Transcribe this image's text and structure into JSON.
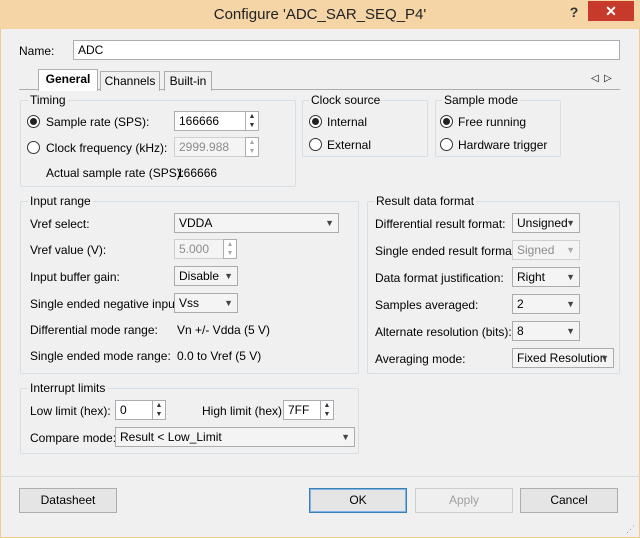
{
  "window": {
    "title": "Configure 'ADC_SAR_SEQ_P4'",
    "help": "?",
    "close": "✕"
  },
  "name": {
    "label": "Name:",
    "value": "ADC"
  },
  "tabs": [
    {
      "label": "General"
    },
    {
      "label": "Channels"
    },
    {
      "label": "Built-in"
    }
  ],
  "tab_scroll": {
    "left": "◁",
    "right": "▷"
  },
  "timing": {
    "title": "Timing",
    "sample_rate_label": "Sample rate (SPS):",
    "sample_rate_value": "166666",
    "clock_freq_label": "Clock frequency (kHz):",
    "clock_freq_value": "2999.988",
    "actual_rate_label": "Actual sample rate (SPS):",
    "actual_rate_value": "166666"
  },
  "clock_source": {
    "title": "Clock source",
    "internal": "Internal",
    "external": "External"
  },
  "sample_mode": {
    "title": "Sample mode",
    "free_running": "Free running",
    "hardware_trigger": "Hardware trigger"
  },
  "input_range": {
    "title": "Input range",
    "vref_select_label": "Vref select:",
    "vref_select_value": "VDDA",
    "vref_value_label": "Vref value (V):",
    "vref_value_value": "5.000",
    "buffer_gain_label": "Input buffer gain:",
    "buffer_gain_value": "Disable",
    "se_neg_input_label": "Single ended negative input:",
    "se_neg_input_value": "Vss",
    "diff_range_label": "Differential mode range:",
    "diff_range_value": "Vn +/- Vdda (5 V)",
    "se_range_label": "Single ended mode range:",
    "se_range_value": "0.0 to Vref (5 V)"
  },
  "result_format": {
    "title": "Result data format",
    "diff_format_label": "Differential result format:",
    "diff_format_value": "Unsigned",
    "se_format_label": "Single ended result format:",
    "se_format_value": "Signed",
    "justification_label": "Data format justification:",
    "justification_value": "Right",
    "samples_avg_label": "Samples averaged:",
    "samples_avg_value": "2",
    "alt_res_label": "Alternate resolution (bits):",
    "alt_res_value": "8",
    "avg_mode_label": "Averaging mode:",
    "avg_mode_value": "Fixed Resolution"
  },
  "interrupt": {
    "title": "Interrupt limits",
    "low_label": "Low limit (hex):",
    "low_value": "0",
    "high_label": "High limit (hex):",
    "high_value": "7FF",
    "compare_label": "Compare mode:",
    "compare_value": "Result < Low_Limit"
  },
  "footer": {
    "datasheet": "Datasheet",
    "ok": "OK",
    "apply": "Apply",
    "cancel": "Cancel"
  },
  "icons": {
    "radio": "radio-icon",
    "dropdown": "chevron-down-icon",
    "spin_up": "▲",
    "spin_down": "▼",
    "arrow": "▼"
  }
}
